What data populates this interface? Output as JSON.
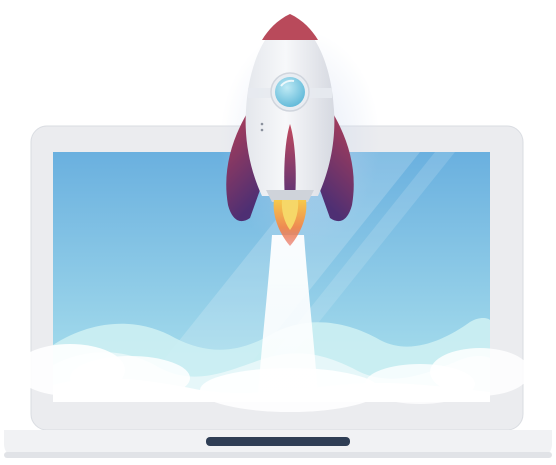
{
  "illustration": {
    "subject": "rocket-launch-from-laptop",
    "icons": [
      "rocket-icon",
      "laptop-icon",
      "cloud-icon"
    ]
  },
  "colors": {
    "laptop_bezel": "#ebecef",
    "laptop_bezel_edge": "#d6d8dd",
    "laptop_base": "#f1f2f4",
    "laptop_base_shadow": "#e1e3e7",
    "trackpad_notch": "#2f3e55",
    "screen_top": "#6ab0df",
    "screen_bottom": "#aee3ee",
    "cloud_light": "#ffffff",
    "cloud_mid": "#dff3f7",
    "cloud_teal": "#bfe9ef",
    "rocket_body": "#f2f3f6",
    "rocket_body_shade": "#d9dce3",
    "rocket_fin_top": "#b53f56",
    "rocket_fin_bottom": "#4e2f73",
    "rocket_nose": "#b94a5b",
    "porthole": "#7fd0e8",
    "porthole_ring": "#e9edf2",
    "flame_outer": "#e9685a",
    "flame_inner": "#f6c94a",
    "exhaust": "#ffffff"
  }
}
